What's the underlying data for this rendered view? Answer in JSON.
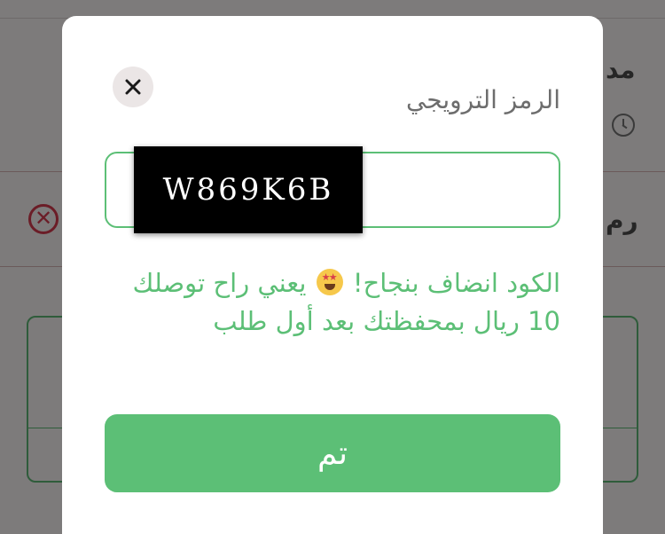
{
  "background": {
    "top_text": "",
    "row1_text": "مد",
    "row2_text": "رم"
  },
  "modal": {
    "title": "الرمز الترويجي",
    "close_icon": "close-icon",
    "promo_code": "W869K6B",
    "message_part1": "الكود انضاف بنجاح!",
    "message_emoji": "star-struck-emoji",
    "message_part2": "يعني راح توصلك 10 ريال بمحفظتك بعد أول طلب",
    "done_label": "تم"
  },
  "colors": {
    "accent_green": "#5cbf76",
    "overlay": "#7d7b7b",
    "close_bg": "#ebe6e6"
  }
}
